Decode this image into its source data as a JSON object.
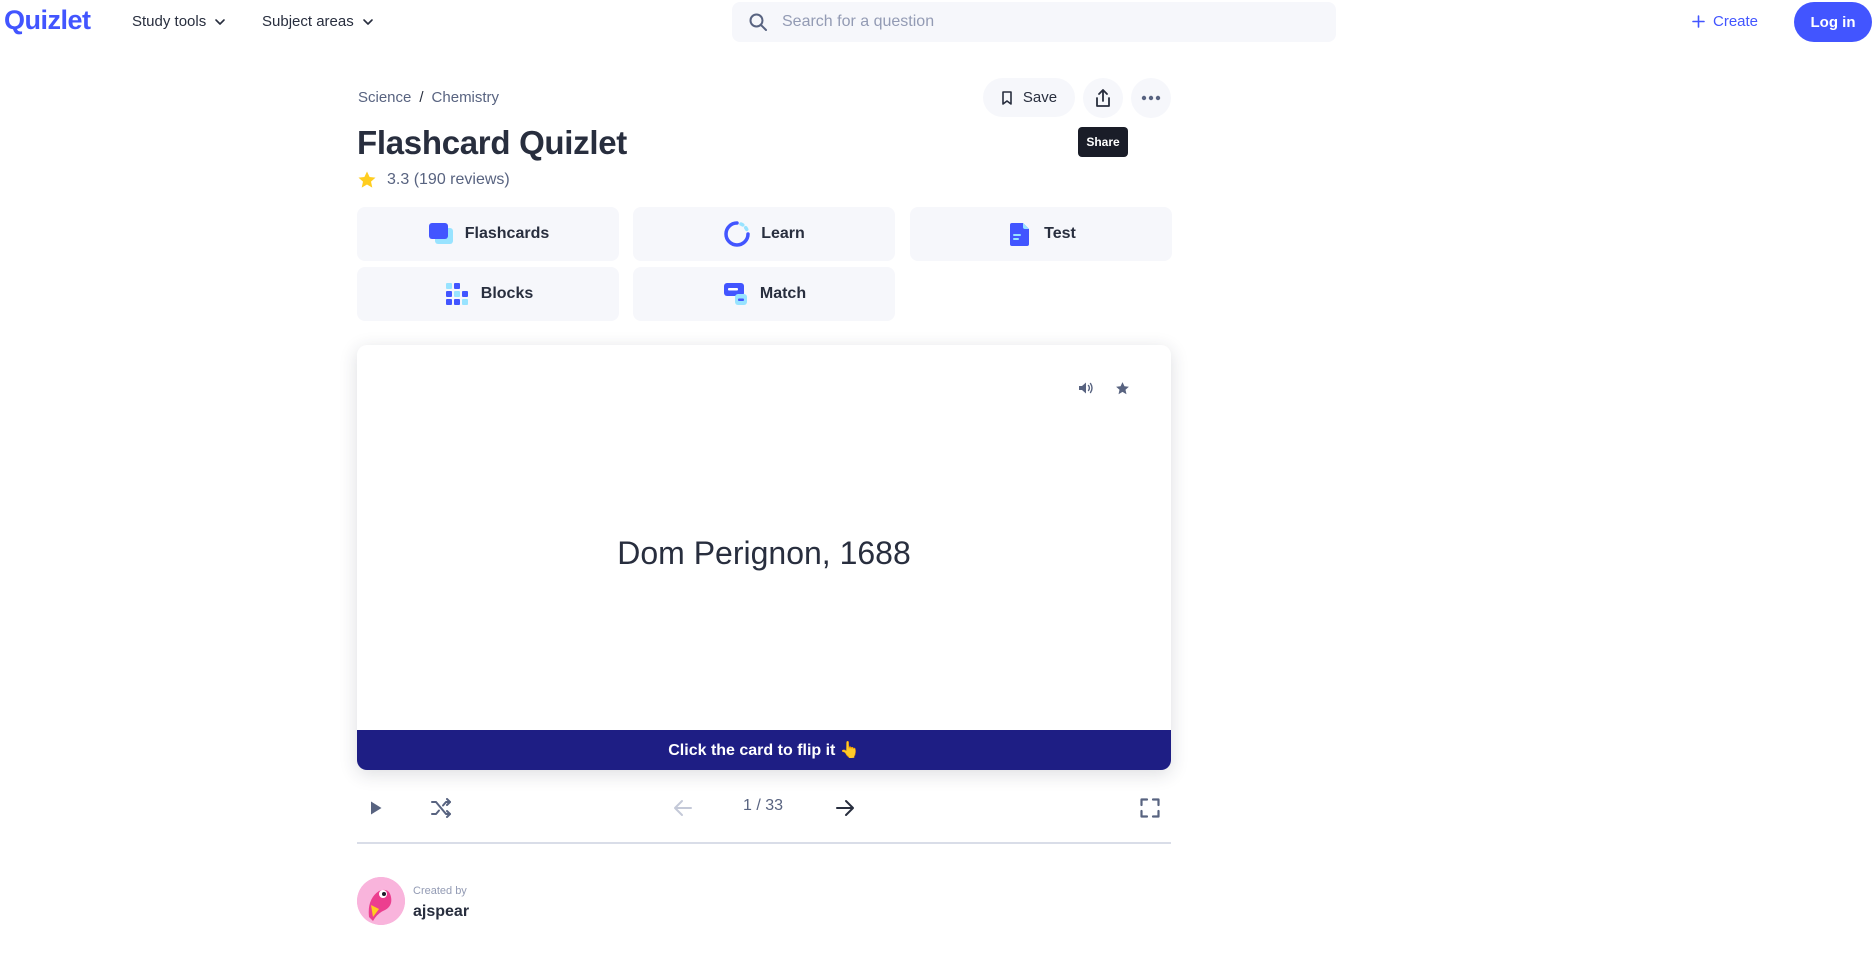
{
  "nav": {
    "logo": "Quizlet",
    "study_tools": "Study tools",
    "subject_areas": "Subject areas",
    "search_placeholder": "Search for a question",
    "create": "Create",
    "login": "Log in"
  },
  "breadcrumb": {
    "items": [
      "Science",
      "Chemistry"
    ],
    "separator": "/"
  },
  "actions": {
    "save": "Save",
    "share_tooltip": "Share"
  },
  "set": {
    "title": "Flashcard Quizlet",
    "rating": "3.3",
    "reviews": "(190 reviews)"
  },
  "modes": [
    {
      "label": "Flashcards",
      "icon": "flashcards-icon"
    },
    {
      "label": "Learn",
      "icon": "learn-icon"
    },
    {
      "label": "Test",
      "icon": "test-icon"
    },
    {
      "label": "Blocks",
      "icon": "blocks-icon"
    },
    {
      "label": "Match",
      "icon": "match-icon"
    }
  ],
  "card": {
    "term": "Dom Perignon, 1688",
    "flip_hint": "Click the card to flip it 👆"
  },
  "controls": {
    "counter": "1 / 33"
  },
  "creator": {
    "created_by_label": "Created by",
    "name": "ajspear"
  },
  "colors": {
    "brand": "#4255ff",
    "flip_bar": "#1e1e84",
    "star": "#ffcd1f",
    "text": "#282e3e",
    "muted": "#586380"
  }
}
